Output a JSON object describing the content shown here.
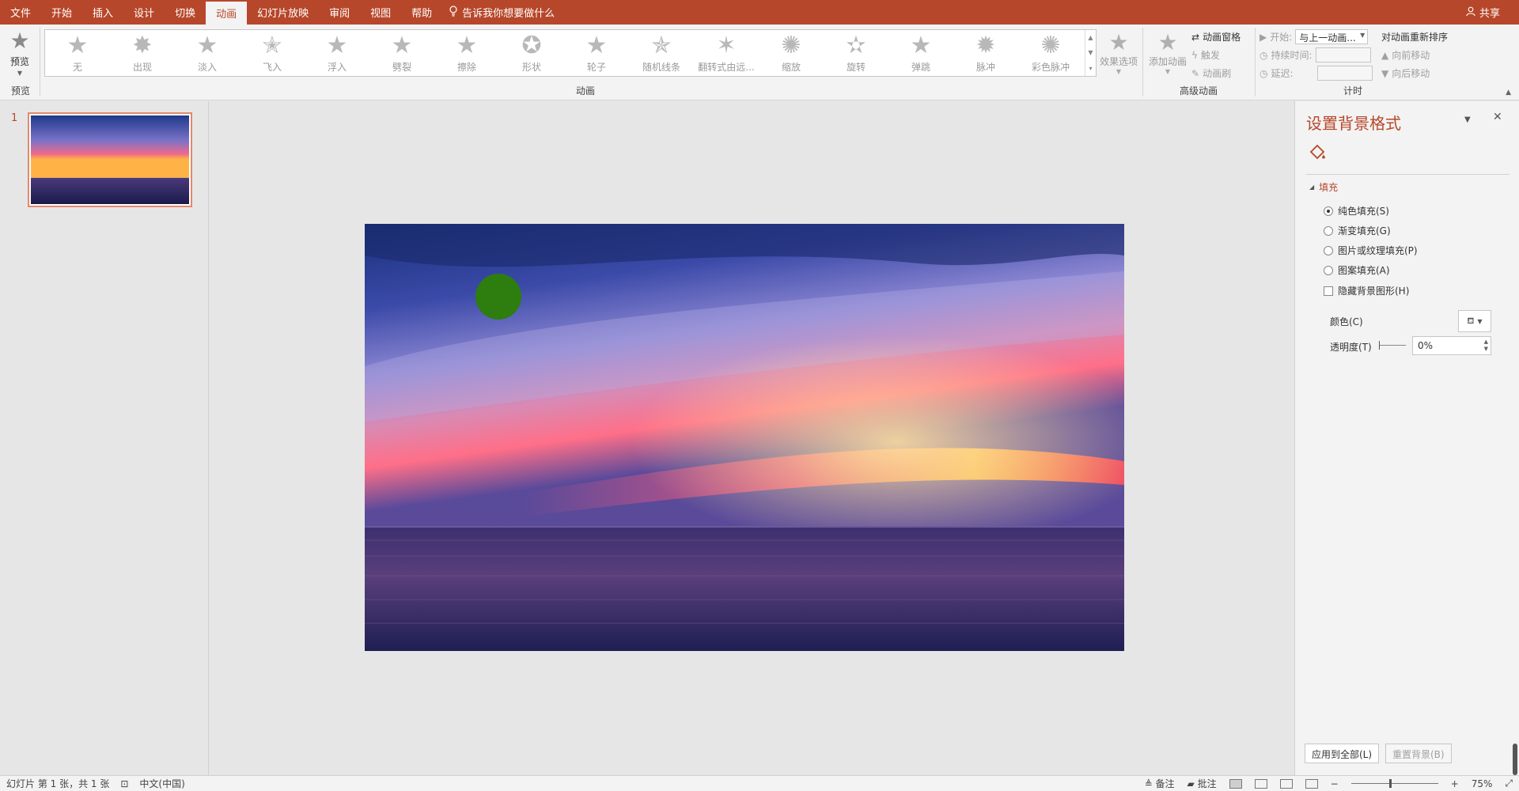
{
  "menu": {
    "items": [
      "文件",
      "开始",
      "插入",
      "设计",
      "切换",
      "动画",
      "幻灯片放映",
      "审阅",
      "视图",
      "帮助"
    ],
    "active": "动画",
    "tell_me": "告诉我你想要做什么",
    "share": "共享"
  },
  "ribbon": {
    "preview": {
      "label": "预览",
      "group_label": "预览"
    },
    "animation_group_label": "动画",
    "animations": [
      "无",
      "出现",
      "淡入",
      "飞入",
      "浮入",
      "劈裂",
      "擦除",
      "形状",
      "轮子",
      "随机线条",
      "翻转式由远...",
      "缩放",
      "旋转",
      "弹跳",
      "脉冲",
      "彩色脉冲"
    ],
    "effect_options": "效果选项",
    "advanced": {
      "group_label": "高级动画",
      "add_animation": "添加动画",
      "pane": "动画窗格",
      "trigger": "触发",
      "painter": "动画刷"
    },
    "timing": {
      "group_label": "计时",
      "start_label": "开始:",
      "start_value": "与上一动画...",
      "duration_label": "持续时间:",
      "delay_label": "延迟:",
      "reorder_title": "对动画重新排序",
      "move_earlier": "向前移动",
      "move_later": "向后移动"
    }
  },
  "thumbnails": {
    "slide_number": "1"
  },
  "pane": {
    "title": "设置背景格式",
    "section": "填充",
    "options": [
      {
        "label": "纯色填充(S)",
        "selected": true
      },
      {
        "label": "渐变填充(G)",
        "selected": false
      },
      {
        "label": "图片或纹理填充(P)",
        "selected": false
      },
      {
        "label": "图案填充(A)",
        "selected": false
      }
    ],
    "hide_bg": "隐藏背景图形(H)",
    "color_label": "颜色(C)",
    "transparency_label": "透明度(T)",
    "transparency_value": "0%",
    "apply_all": "应用到全部(L)",
    "reset_bg": "重置背景(B)"
  },
  "status": {
    "slide_info": "幻灯片 第 1 张，共 1 张",
    "language": "中文(中国)",
    "notes": "备注",
    "comments": "批注",
    "zoom": "75%"
  },
  "colors": {
    "accent": "#b7472a",
    "circle": "#2e7d0f"
  }
}
